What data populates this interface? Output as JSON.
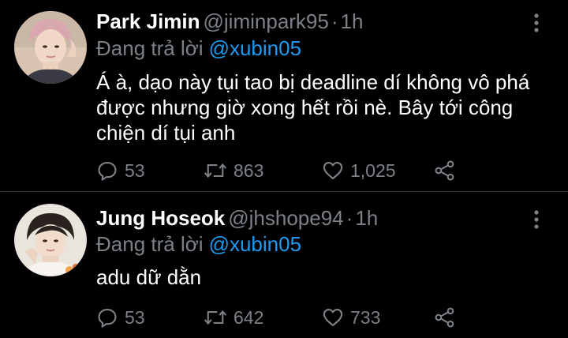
{
  "colors": {
    "background": "#000000",
    "text": "#ffffff",
    "muted": "#7b8187",
    "link": "#1d9bf0",
    "divider": "#2f3336"
  },
  "tweets": [
    {
      "display_name": "Park Jimin",
      "handle": "@jiminpark95",
      "separator": "·",
      "time": "1h",
      "reply_prefix": "Đang trả lời",
      "reply_to": "@xubin05",
      "text": "Á à, dạo này tụi tao bị deadline dí không vô phá được nhưng giờ xong hết rồi nè. Bây tới công chiện dí tụi anh",
      "replies": "53",
      "retweets": "863",
      "likes": "1,025",
      "icons": [
        "reply-icon",
        "retweet-icon",
        "like-icon",
        "share-icon",
        "more-options-icon"
      ]
    },
    {
      "display_name": "Jung Hoseok",
      "handle": "@jhshope94",
      "separator": "·",
      "time": "1h",
      "reply_prefix": "Đang trả lời",
      "reply_to": "@xubin05",
      "text": "adu dữ dằn",
      "replies": "53",
      "retweets": "642",
      "likes": "733",
      "icons": [
        "reply-icon",
        "retweet-icon",
        "like-icon",
        "share-icon",
        "more-options-icon"
      ]
    }
  ]
}
